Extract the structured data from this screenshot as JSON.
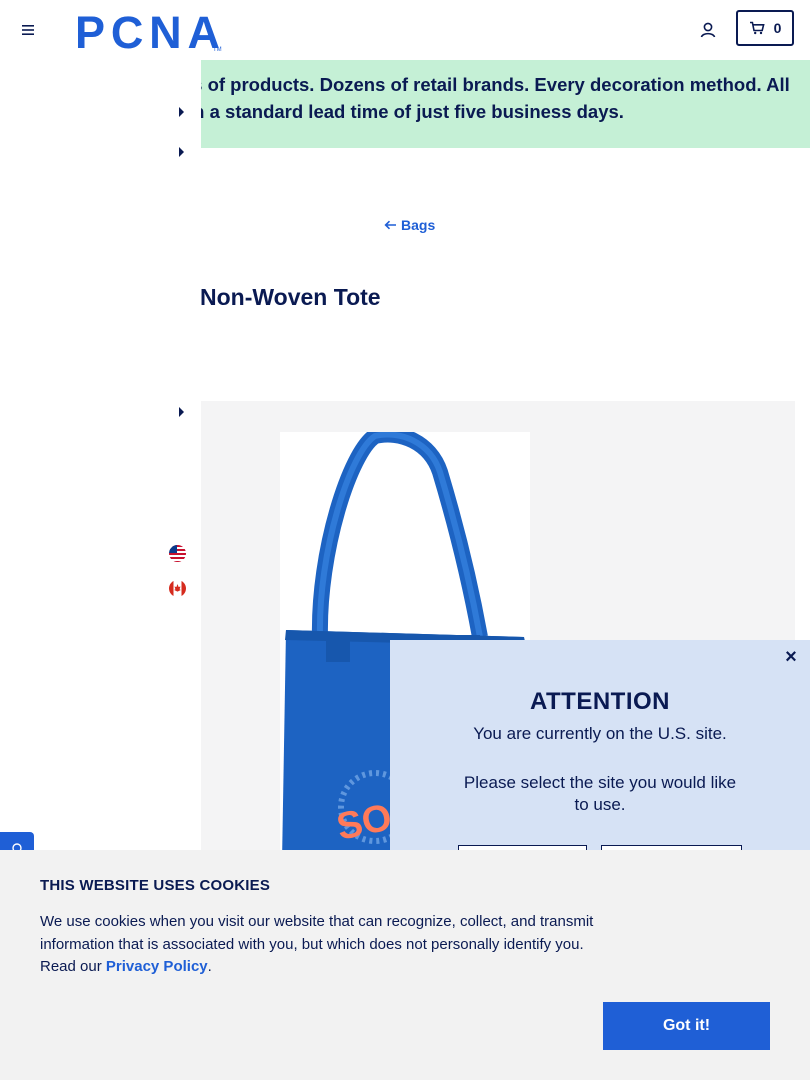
{
  "header": {
    "logo_text": "PCNA",
    "cart_count": "0",
    "icons": {
      "menu": "hamburger-menu-icon",
      "account": "user-icon",
      "cart": "cart-icon"
    }
  },
  "promo": {
    "line1": "ls of products. Dozens of retail brands. Every decoration method. All",
    "line2": "th a standard lead time of just five business days."
  },
  "breadcrumb": {
    "back_label": "Bags"
  },
  "product": {
    "title": "Non-Woven Tote",
    "image_alt": "Blue non-woven tote bag"
  },
  "region_modal": {
    "title": "ATTENTION",
    "line1": "You are currently on the U.S. site.",
    "line2": "Please select the site you would like to use.",
    "close_label": "×"
  },
  "cookies": {
    "title": "THIS WEBSITE USES COOKIES",
    "text": "We use cookies when you visit our website that can recognize, collect, and transmit information that is associated with you, but which does not personally identify you. Read our",
    "link_label": "Privacy Policy",
    "period": ".",
    "accept_label": "Got it!"
  },
  "colors": {
    "navy": "#0a1a52",
    "brand_blue": "#1f5fd6",
    "promo_green": "#c5f0d6",
    "modal_bg": "#d6e2f5",
    "cookie_bg": "#f2f2f2"
  }
}
